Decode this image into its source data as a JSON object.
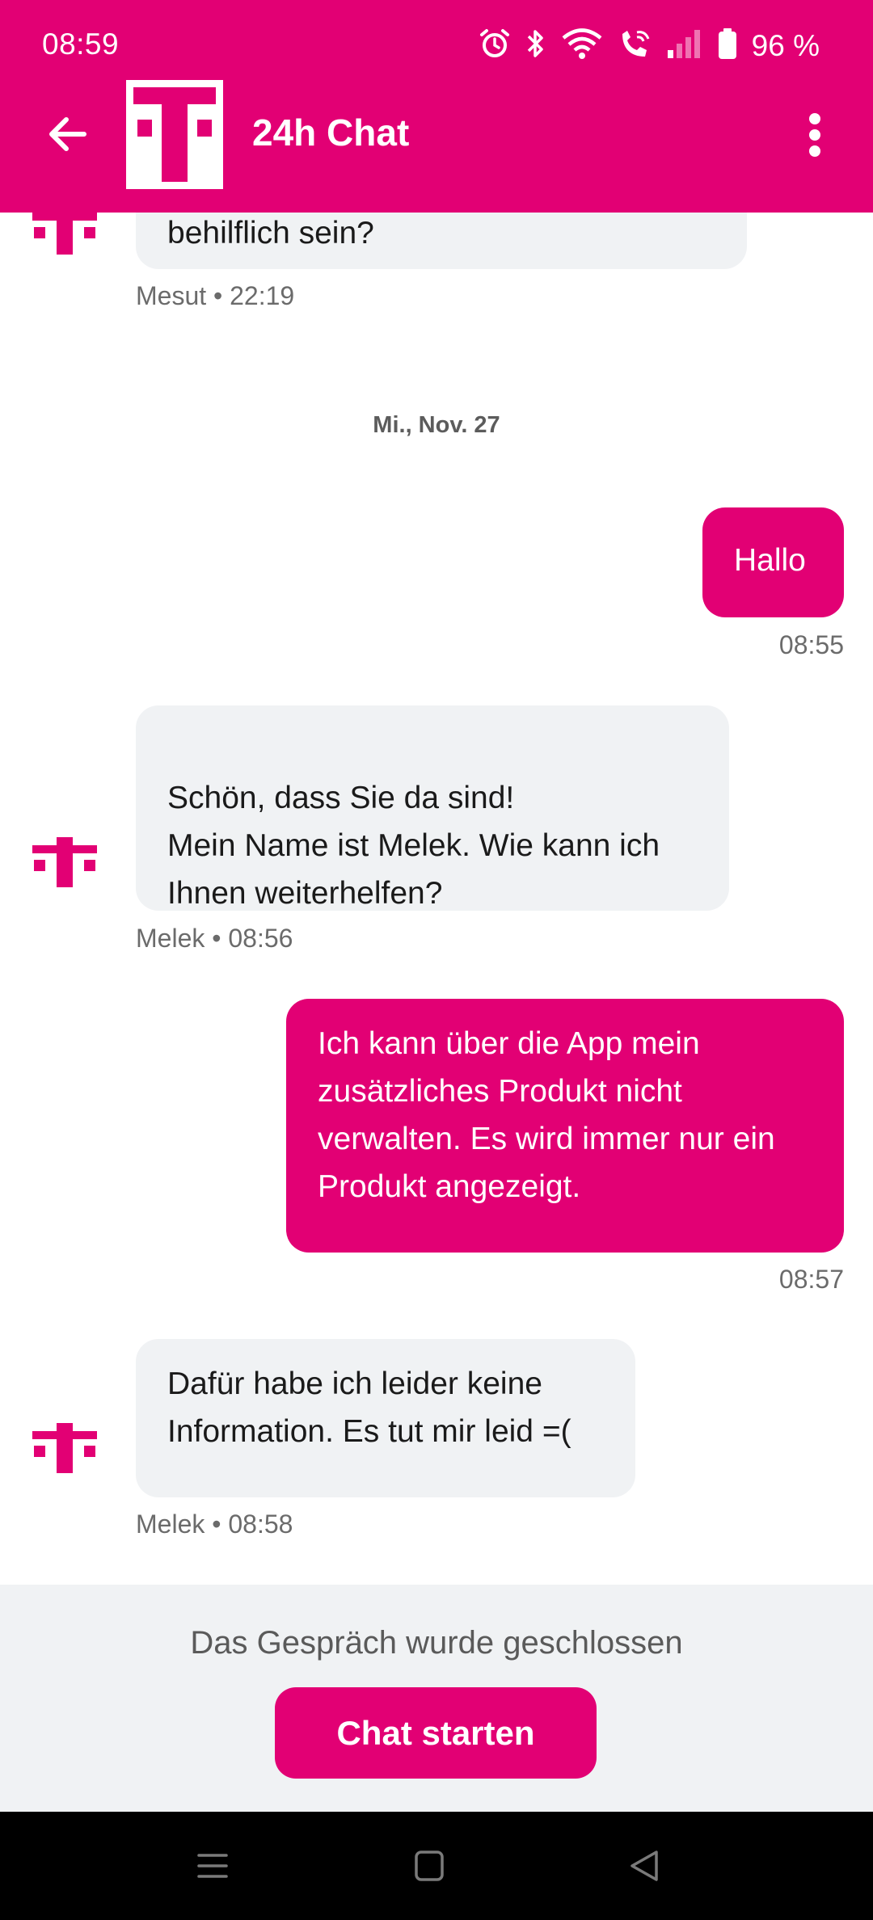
{
  "status_bar": {
    "time": "08:59",
    "battery": "96 %",
    "icons": [
      "alarm-icon",
      "bluetooth-icon",
      "wifi-icon",
      "wifi-call-icon",
      "signal-icon",
      "battery-icon"
    ]
  },
  "app_bar": {
    "title": "24h Chat",
    "back_icon": "back-arrow-icon",
    "menu_icon": "more-vert-icon",
    "logo": "telekom-t-logo"
  },
  "colors": {
    "brand": "#e20074",
    "agent_bubble": "#f0f2f4",
    "footer_bg": "#f0f2f4"
  },
  "chat": {
    "partial_message": {
      "text": "behilflich sein?",
      "meta": "Mesut • 22:19"
    },
    "date_separator": "Mi., Nov. 27",
    "messages": [
      {
        "from": "user",
        "text": "Hallo",
        "meta": "08:55"
      },
      {
        "from": "agent",
        "text": "Schön, dass Sie da sind!\nMein Name ist Melek. Wie kann ich Ihnen weiterhelfen?",
        "meta": "Melek • 08:56"
      },
      {
        "from": "user",
        "text": "Ich kann über die App mein zusätzliches Produkt nicht verwalten. Es wird immer nur ein Produkt angezeigt.",
        "meta": "08:57"
      },
      {
        "from": "agent",
        "text": "Dafür habe ich leider keine Information. Es tut mir leid =(",
        "meta": "Melek • 08:58"
      }
    ]
  },
  "footer": {
    "closed_text": "Das Gespräch wurde geschlossen",
    "start_button": "Chat starten"
  },
  "nav_bar": {
    "icons": [
      "recents-icon",
      "home-icon",
      "back-icon"
    ]
  }
}
